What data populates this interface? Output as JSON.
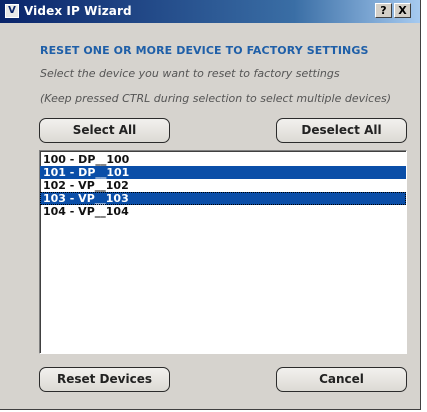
{
  "window": {
    "title": "Videx IP Wizard",
    "help_label": "?",
    "close_label": "X",
    "app_icon": "V"
  },
  "content": {
    "heading": "RESET ONE OR MORE DEVICE TO FACTORY SETTINGS",
    "instruction1": "Select the device you want to reset to factory settings",
    "instruction2": "(Keep pressed CTRL during selection to select multiple devices)"
  },
  "buttons": {
    "select_all": "Select All",
    "deselect_all": "Deselect All",
    "reset_devices": "Reset Devices",
    "cancel": "Cancel"
  },
  "devices": [
    {
      "label": "100 - DP__100",
      "selected": false
    },
    {
      "label": "101 - DP__101",
      "selected": true
    },
    {
      "label": "102 - VP__102",
      "selected": false
    },
    {
      "label": "103 - VP__103",
      "selected": true
    },
    {
      "label": "104 - VP__104",
      "selected": false
    }
  ],
  "colors": {
    "selection": "#0a4ea8",
    "heading": "#1f5fa8",
    "titlebar": "#0a246a"
  }
}
